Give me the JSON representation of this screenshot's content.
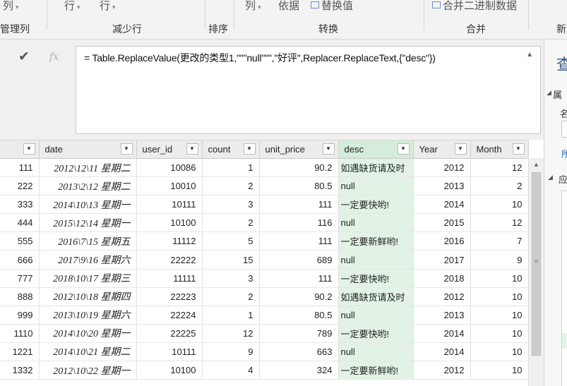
{
  "ribbon": {
    "top_items": [
      {
        "label": "列",
        "caret": "▾"
      },
      {
        "label": "行",
        "caret": "▾"
      },
      {
        "label": "行",
        "caret": "▾"
      },
      {
        "label": "列",
        "caret": "▾"
      },
      {
        "label": "依据",
        "caret": ""
      },
      {
        "label": "替换值",
        "caret": ""
      },
      {
        "label": "合并二进制数据",
        "caret": ""
      }
    ],
    "groups": [
      "管理列",
      "减少行",
      "排序",
      "转换",
      "合并",
      "新"
    ]
  },
  "formula": {
    "confirm_icon": "✔",
    "fx_label": "fx",
    "text": "= Table.ReplaceValue(更改的类型1,\"\"\"null\"\"\",\"好评\",Replacer.ReplaceText,{\"desc\"})",
    "collapse_icon": "▲"
  },
  "right_panel": {
    "title": "查",
    "section_properties": "属",
    "name_label": "名",
    "all_properties_link": "所",
    "section_applied_steps": "应",
    "caret": "◢"
  },
  "table": {
    "filter_icon": "▼",
    "columns": [
      "",
      "date",
      "user_id",
      "count",
      "unit_price",
      "desc",
      "Year",
      "Month"
    ],
    "rows": [
      [
        "111",
        "2012\\12\\11 星期二",
        "10086",
        "1",
        "90.2",
        "如遇缺货请及时",
        "2012",
        "12"
      ],
      [
        "222",
        "2013\\2\\12 星期二",
        "10010",
        "2",
        "80.5",
        "null",
        "2013",
        "2"
      ],
      [
        "333",
        "2014\\10\\13 星期一",
        "10111",
        "3",
        "111",
        "一定要快哟!",
        "2014",
        "10"
      ],
      [
        "444",
        "2015\\12\\14 星期一",
        "10100",
        "2",
        "116",
        "null",
        "2015",
        "12"
      ],
      [
        "555",
        "2016\\7\\15 星期五",
        "11112",
        "5",
        "111",
        "一定要新鲜哟!",
        "2016",
        "7"
      ],
      [
        "666",
        "2017\\9\\16 星期六",
        "22222",
        "15",
        "689",
        "null",
        "2017",
        "9"
      ],
      [
        "777",
        "2018\\10\\17 星期三",
        "11111",
        "3",
        "111",
        "一定要快哟!",
        "2018",
        "10"
      ],
      [
        "888",
        "2012\\10\\18 星期四",
        "22223",
        "2",
        "90.2",
        "如遇缺货请及时",
        "2012",
        "10"
      ],
      [
        "999",
        "2013\\10\\19 星期六",
        "22224",
        "1",
        "80.5",
        "null",
        "2013",
        "10"
      ],
      [
        "1110",
        "2014\\10\\20 星期一",
        "22225",
        "12",
        "789",
        "一定要快哟!",
        "2014",
        "10"
      ],
      [
        "1221",
        "2014\\10\\21 星期二",
        "10111",
        "9",
        "663",
        "null",
        "2014",
        "10"
      ],
      [
        "1332",
        "2012\\10\\22 星期一",
        "10100",
        "4",
        "324",
        "一定要新鲜哟!",
        "2012",
        "10"
      ]
    ]
  },
  "scrollbar": {
    "up_icon": "▲",
    "grip": "≡"
  }
}
